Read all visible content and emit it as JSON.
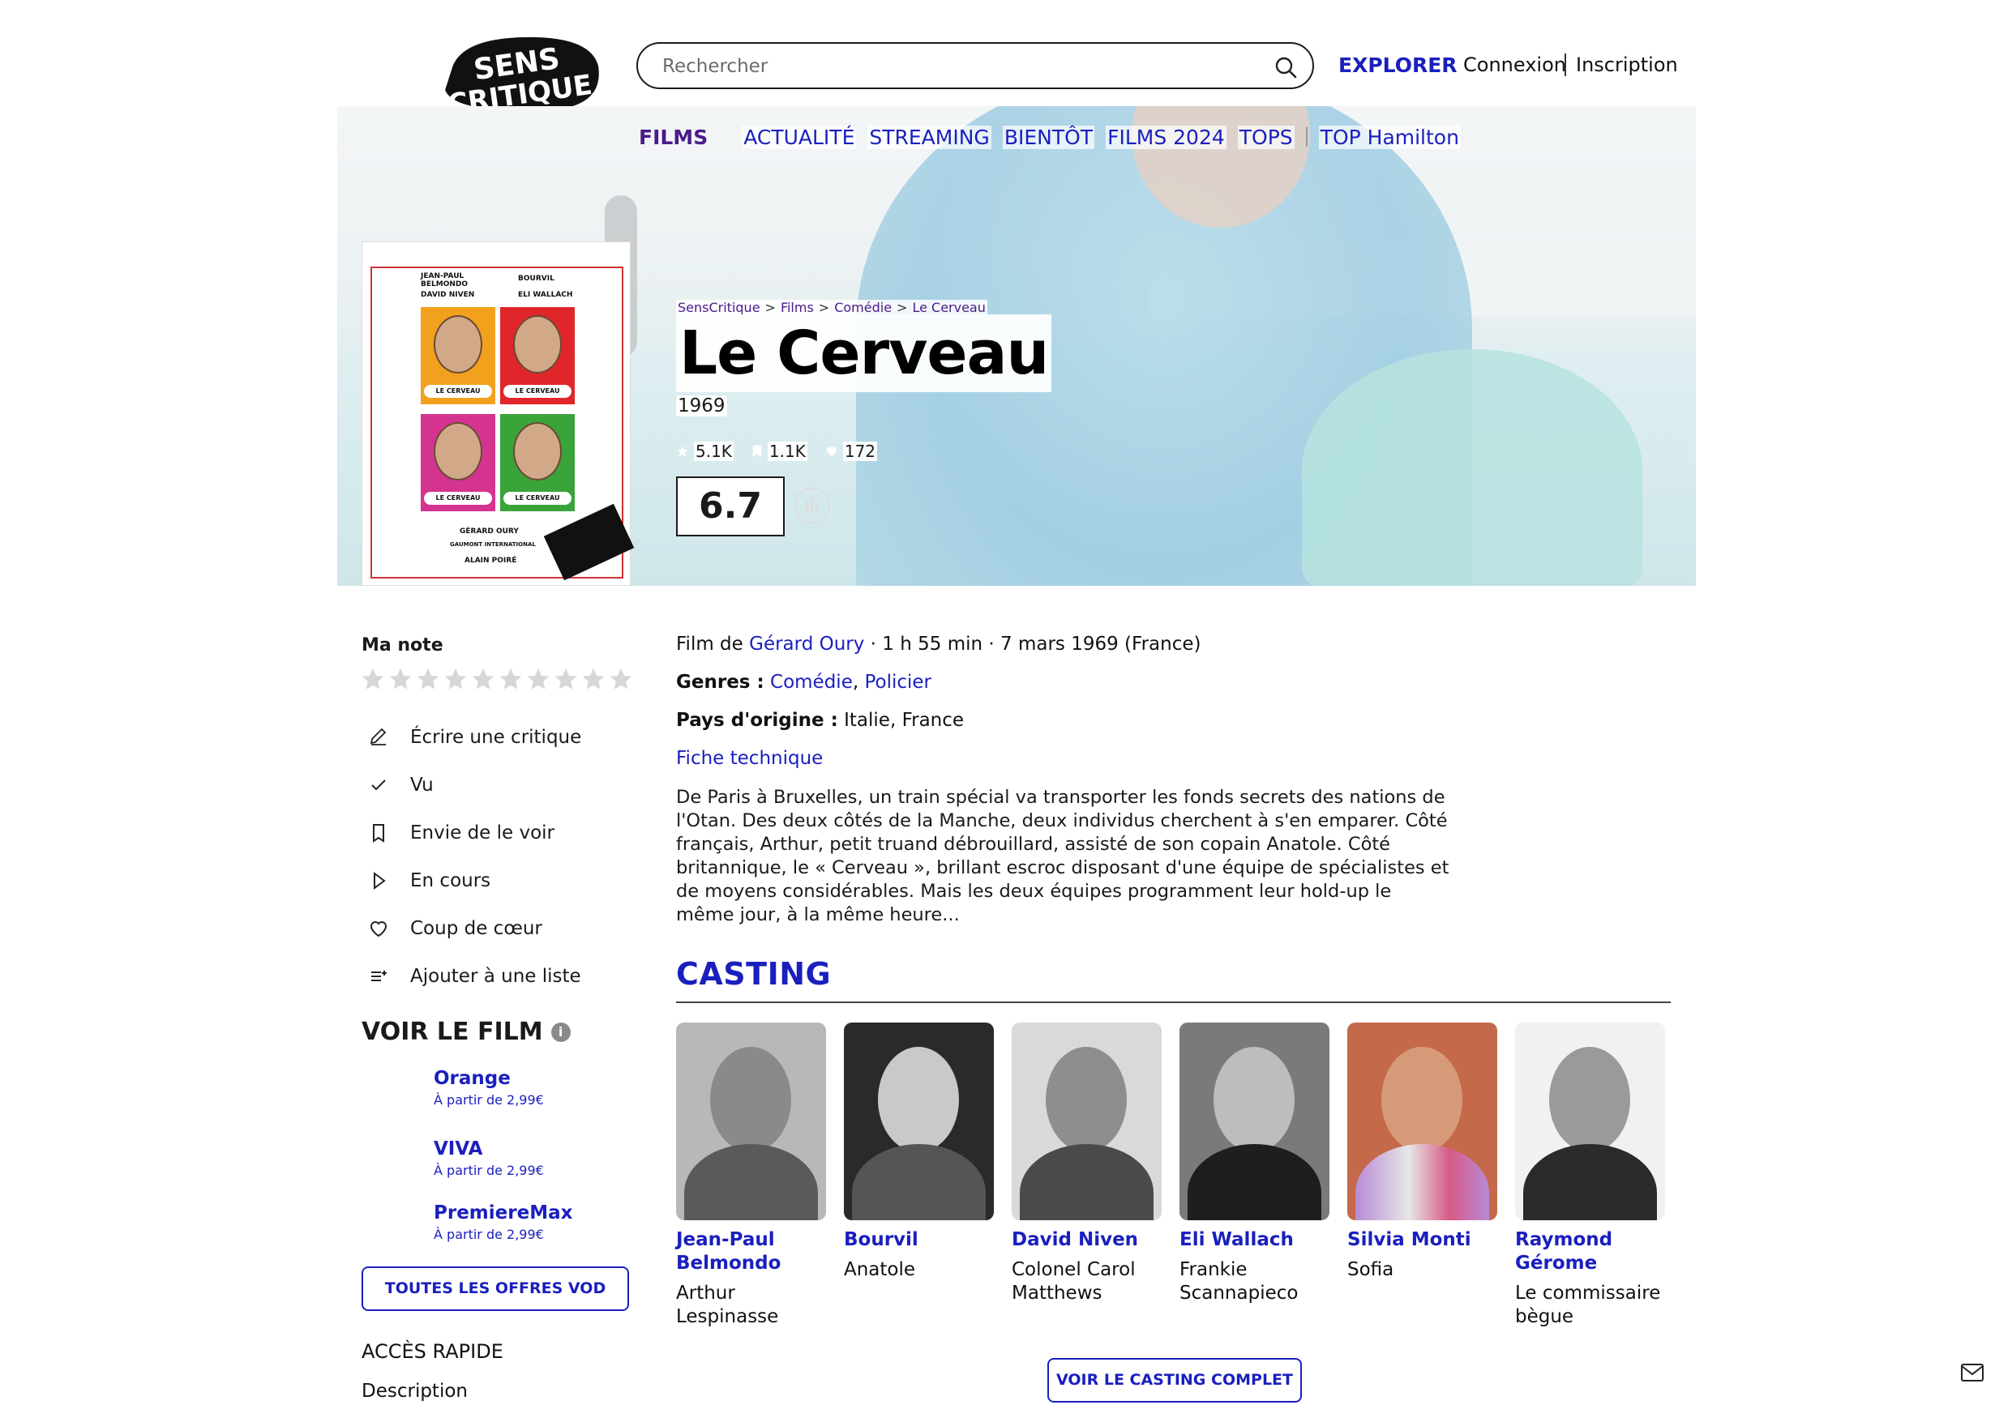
{
  "header": {
    "search_placeholder": "Rechercher",
    "explore": "EXPLORER",
    "login": "Connexion",
    "signup": "Inscription",
    "logo_line1": "SENS",
    "logo_line2": "CRITIQUE"
  },
  "nav": {
    "items": [
      "FILMS",
      "ACTUALITÉ",
      "STREAMING",
      "BIENTÔT",
      "FILMS 2024",
      "TOPS",
      "TOP Hamilton"
    ]
  },
  "breadcrumb": [
    "SensCritique",
    "Films",
    "Comédie",
    "Le Cerveau"
  ],
  "movie": {
    "title": "Le Cerveau",
    "year": "1969",
    "ratings_count": "5.1K",
    "wish_count": "1.1K",
    "favorites_count": "172",
    "score": "6.7",
    "director_prefix": "Film de",
    "director": "Gérard Oury",
    "meta": "· 1 h 55 min · 7 mars 1969 (France)",
    "genres_label": "Genres :",
    "genres": [
      "Comédie",
      "Policier"
    ],
    "countries_label": "Pays d'origine :",
    "countries": "Italie, France",
    "tech_sheet": "Fiche technique",
    "synopsis": "De Paris à Bruxelles, un train spécial va transporter les fonds secrets des nations de l'Otan. Des deux côtés de la Manche, deux individus cherchent à s'en emparer. Côté français, Arthur, petit truand débrouillard, assisté de son copain Anatole. Côté britannique, le « Cerveau », brillant escroc disposant d'une équipe de spécialistes et de moyens considérables. Mais les deux équipes programment leur hold-up le même jour, à la même heure..."
  },
  "poster": {
    "names": [
      "JEAN-PAUL BELMONDO",
      "BOURVIL",
      "DAVID NIVEN",
      "ELI WALLACH"
    ],
    "panel_label": "LE CERVEAU",
    "director": "GÉRARD OURY",
    "producer": "ALAIN POIRÉ",
    "studio": "GAUMONT INTERNATIONAL",
    "panel_colors": [
      "#f2a11e",
      "#e0262a",
      "#d4348f",
      "#3aa33a"
    ]
  },
  "sidebar": {
    "my_note": "Ma note",
    "actions": [
      {
        "icon": "pencil-icon",
        "label": "Écrire une critique"
      },
      {
        "icon": "check-icon",
        "label": "Vu"
      },
      {
        "icon": "bookmark-icon",
        "label": "Envie de le voir"
      },
      {
        "icon": "play-icon",
        "label": "En cours"
      },
      {
        "icon": "heart-icon",
        "label": "Coup de cœur"
      },
      {
        "icon": "list-add-icon",
        "label": "Ajouter à une liste"
      }
    ],
    "watch_title": "VOIR LE FILM",
    "vod": [
      {
        "name": "Orange",
        "price": "À partir de 2,99€"
      },
      {
        "name": "VIVA",
        "price": "À partir de 2,99€"
      },
      {
        "name": "PremiereMax",
        "price": "À partir de 2,99€"
      }
    ],
    "vod_all": "TOUTES LES OFFRES VOD",
    "quick_access": "ACCÈS RAPIDE",
    "quick_desc": "Description"
  },
  "casting": {
    "title": "CASTING",
    "actors": [
      {
        "name": "Jean-Paul Belmondo",
        "role": "Arthur Lespinasse"
      },
      {
        "name": "Bourvil",
        "role": "Anatole"
      },
      {
        "name": "David Niven",
        "role": "Colonel Carol Matthews"
      },
      {
        "name": "Eli Wallach",
        "role": "Frankie Scannapieco"
      },
      {
        "name": "Silvia Monti",
        "role": "Sofia"
      },
      {
        "name": "Raymond Gérome",
        "role": "Le commissaire bègue"
      }
    ],
    "see_all": "VOIR LE CASTING COMPLET"
  },
  "colors": {
    "accent": "#1a1fbe",
    "nav_active": "#4b1a8a"
  }
}
